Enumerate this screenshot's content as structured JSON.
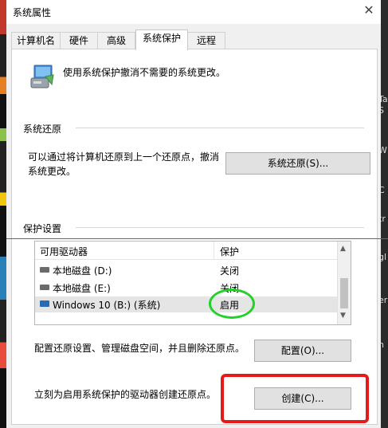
{
  "window": {
    "title": "系统属性"
  },
  "tabs": [
    {
      "label": "计算机名"
    },
    {
      "label": "硬件"
    },
    {
      "label": "高级"
    },
    {
      "label": "系统保护"
    },
    {
      "label": "远程"
    }
  ],
  "intro": {
    "text": "使用系统保护撤消不需要的系统更改。"
  },
  "restore": {
    "title": "系统还原",
    "desc_line1": "可以通过将计算机还原到上一个还原点，撤消",
    "desc_line2": "系统更改。",
    "button": "系统还原(S)..."
  },
  "protection": {
    "title": "保护设置",
    "col_drive": "可用驱动器",
    "col_protect": "保护",
    "drives": [
      {
        "name": "本地磁盘 (D:)",
        "state": "关闭"
      },
      {
        "name": "本地磁盘 (E:)",
        "state": "关闭"
      },
      {
        "name": "Windows 10 (B:) (系统)",
        "state": "启用"
      }
    ],
    "config_desc": "配置还原设置、管理磁盘空间，并且删除还原点。",
    "config_button": "配置(O)...",
    "create_desc": "立刻为启用系统保护的驱动器创建还原点。",
    "create_button": "创建(C)..."
  },
  "desktop": {
    "right_chars": [
      "Ta",
      "S",
      "W",
      "C",
      "tr",
      "gl",
      "er",
      "n",
      "l"
    ]
  },
  "colors": {
    "annotation_red": "#e41b17",
    "annotation_green": "#22d12a",
    "selection": "#e5e5e5"
  }
}
